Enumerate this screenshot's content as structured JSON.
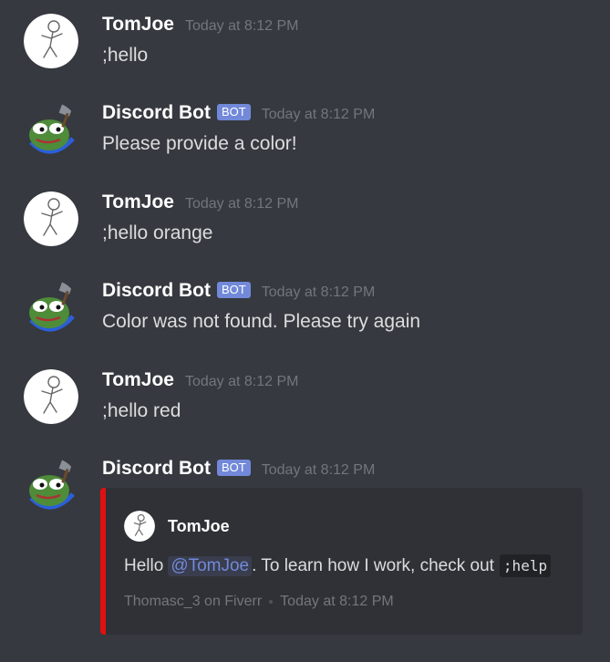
{
  "messages": [
    {
      "username": "TomJoe",
      "timestamp": "Today at 8:12 PM",
      "content": ";hello",
      "is_bot": false
    },
    {
      "username": "Discord Bot",
      "bot_tag": "BOT",
      "timestamp": "Today at 8:12 PM",
      "content": "Please provide a color!",
      "is_bot": true
    },
    {
      "username": "TomJoe",
      "timestamp": "Today at 8:12 PM",
      "content": ";hello orange",
      "is_bot": false
    },
    {
      "username": "Discord Bot",
      "bot_tag": "BOT",
      "timestamp": "Today at 8:12 PM",
      "content": "Color was not found. Please try again",
      "is_bot": true
    },
    {
      "username": "TomJoe",
      "timestamp": "Today at 8:12 PM",
      "content": ";hello red",
      "is_bot": false
    },
    {
      "username": "Discord Bot",
      "bot_tag": "BOT",
      "timestamp": "Today at 8:12 PM",
      "content": "",
      "is_bot": true
    }
  ],
  "embed": {
    "color": "#e01010",
    "author_name": "TomJoe",
    "description_prefix": "Hello",
    "mention": "@TomJoe",
    "description_middle": ". To learn how I work, check out",
    "code": ";help",
    "footer_text": "Thomasc_3 on Fiverr",
    "footer_timestamp": "Today at 8:12 PM"
  },
  "colors": {
    "background": "#36393f",
    "embed_background": "#2f3136",
    "bot_tag": "#7289da",
    "mention": "#7289da"
  },
  "icons": {
    "user_avatar": "stick-figure-avatar",
    "bot_avatar": "frog-avatar"
  }
}
